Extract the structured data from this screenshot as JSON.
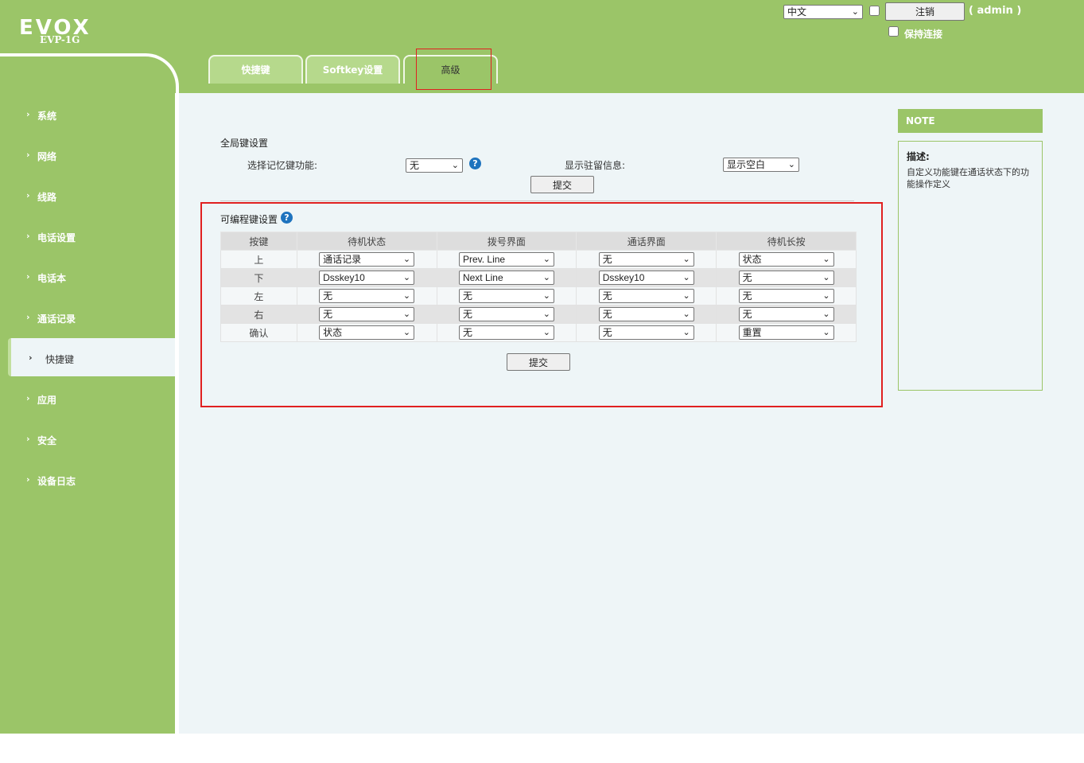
{
  "brand": {
    "name": "EVOX",
    "model": "EVP-1G"
  },
  "header": {
    "language": "中文",
    "logout_label": "注销",
    "user_label": "( admin )",
    "keep_connected_label": "保持连接"
  },
  "tabs": [
    {
      "label": "快捷键",
      "active": false
    },
    {
      "label": "Softkey设置",
      "active": false
    },
    {
      "label": "高级",
      "active": true
    }
  ],
  "sidebar": {
    "items": [
      {
        "label": "系统",
        "active": false
      },
      {
        "label": "网络",
        "active": false
      },
      {
        "label": "线路",
        "active": false
      },
      {
        "label": "电话设置",
        "active": false
      },
      {
        "label": "电话本",
        "active": false
      },
      {
        "label": "通话记录",
        "active": false
      },
      {
        "label": "快捷键",
        "active": true
      },
      {
        "label": "应用",
        "active": false
      },
      {
        "label": "安全",
        "active": false
      },
      {
        "label": "设备日志",
        "active": false
      }
    ]
  },
  "global_keys": {
    "title": "全局键设置",
    "memory_key_label": "选择记忆键功能:",
    "memory_key_value": "无",
    "idle_display_label": "显示驻留信息:",
    "idle_display_value": "显示空白",
    "submit_label": "提交"
  },
  "programmable_keys": {
    "title": "可编程键设置",
    "columns": [
      "按键",
      "待机状态",
      "拨号界面",
      "通话界面",
      "待机长按"
    ],
    "rows": [
      {
        "key": "上",
        "idle": "通话记录",
        "dial": "Prev. Line",
        "talk": "无",
        "long_press": "状态"
      },
      {
        "key": "下",
        "idle": "Dsskey10",
        "dial": "Next Line",
        "talk": "Dsskey10",
        "long_press": "无"
      },
      {
        "key": "左",
        "idle": "无",
        "dial": "无",
        "talk": "无",
        "long_press": "无"
      },
      {
        "key": "右",
        "idle": "无",
        "dial": "无",
        "talk": "无",
        "long_press": "无"
      },
      {
        "key": "确认",
        "idle": "状态",
        "dial": "无",
        "talk": "无",
        "long_press": "重置"
      }
    ],
    "submit_label": "提交"
  },
  "note": {
    "heading": "NOTE",
    "title": "描述:",
    "text": "自定义功能键在通话状态下的功能操作定义"
  },
  "colors": {
    "brand_green": "#9bc568",
    "content_bg": "#eef5f7",
    "highlight_red": "#e02020",
    "help_blue": "#1e73be"
  }
}
